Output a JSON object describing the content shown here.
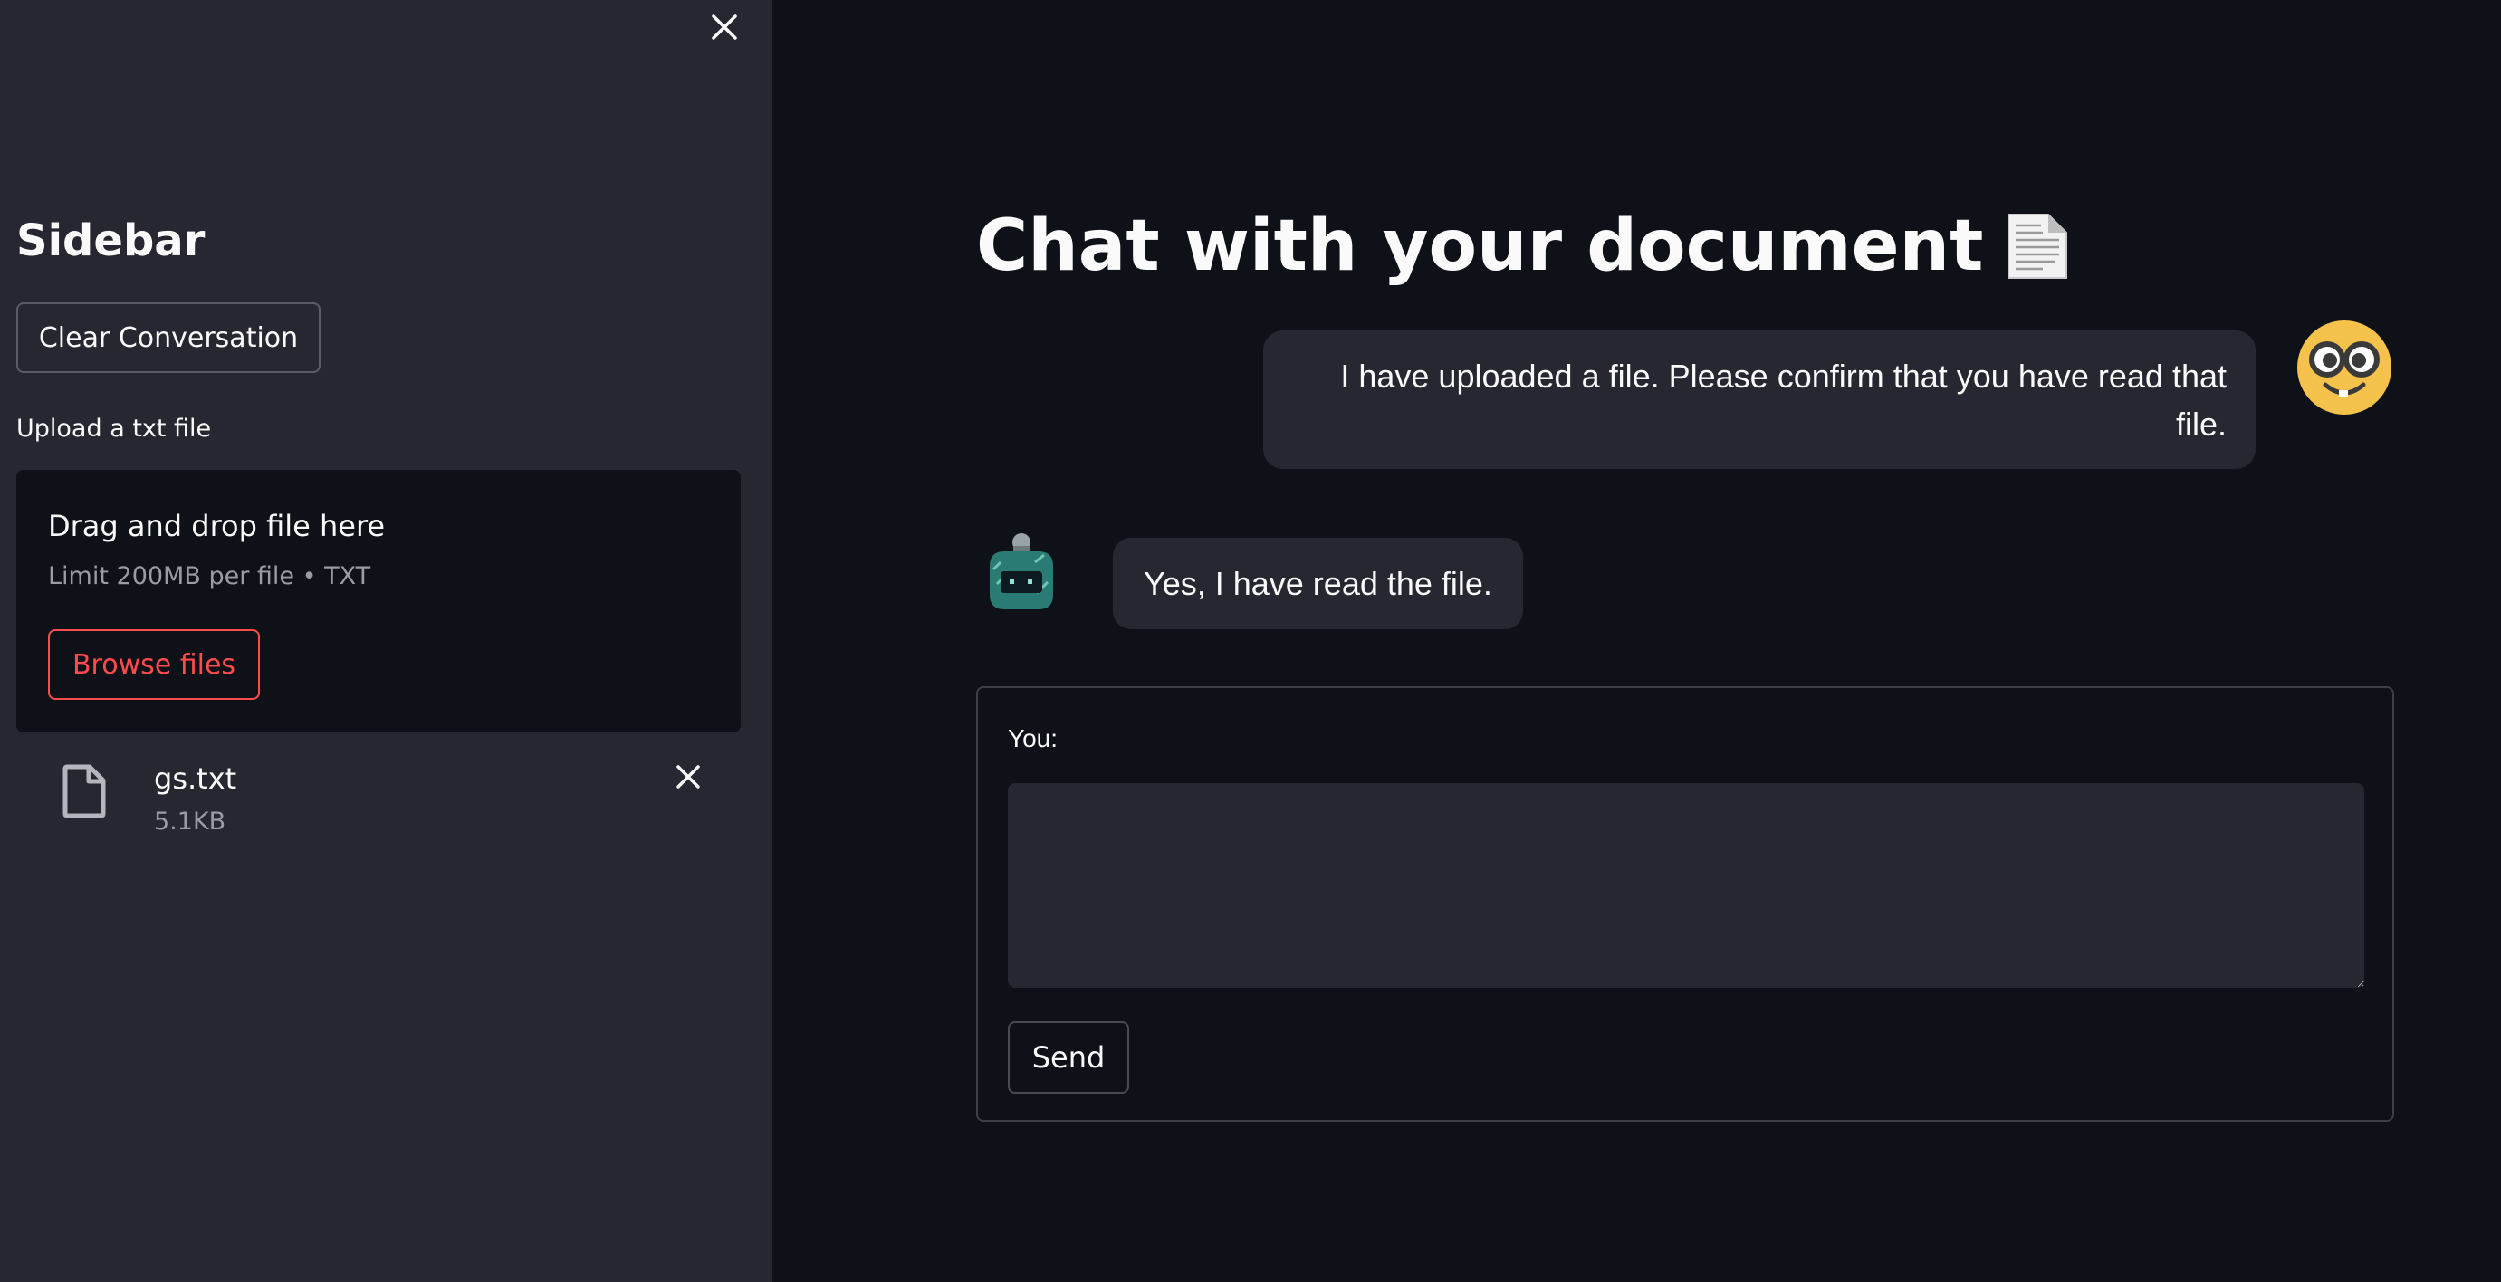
{
  "colors": {
    "sidebar_bg": "#262730",
    "main_bg": "#0e1117",
    "accent": "#ff4b4b",
    "text": "#fafafa",
    "muted_text": "#9a9ba3"
  },
  "sidebar": {
    "close_icon": "close-icon",
    "title": "Sidebar",
    "clear_button_label": "Clear Conversation",
    "upload": {
      "label": "Upload a txt file",
      "dropzone_title": "Drag and drop file here",
      "dropzone_limit": "Limit 200MB per file • TXT",
      "browse_button_label": "Browse files"
    },
    "uploaded_file": {
      "icon": "file-icon",
      "name": "gs.txt",
      "size": "5.1KB",
      "remove_icon": "close-icon"
    }
  },
  "main": {
    "title": "Chat with your document",
    "title_icon": "document-icon",
    "messages": [
      {
        "role": "user",
        "avatar": "nerd-face-avatar",
        "text": "I have uploaded a file. Please confirm that you have read that file."
      },
      {
        "role": "assistant",
        "avatar": "robot-avatar",
        "text": "Yes, I have read the file."
      }
    ],
    "input": {
      "label": "You:",
      "value": "",
      "send_button_label": "Send"
    }
  }
}
